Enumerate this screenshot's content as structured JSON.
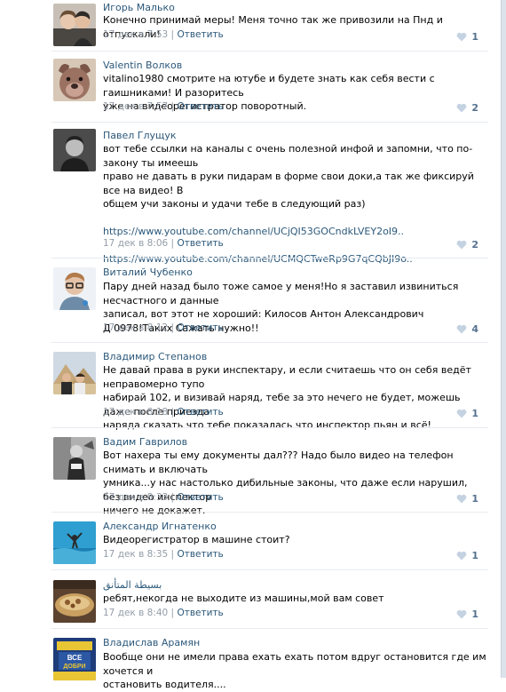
{
  "ui": {
    "reply_label": "Ответить",
    "separator": "|"
  },
  "comments": [
    {
      "author": "Игорь Малько",
      "lines": [
        "Конечно принимай меры! Меня точно так же привозили на Пнд и отпускали!"
      ],
      "time": "17 дек в 7:53",
      "likes": "1"
    },
    {
      "author": "Valentin Волков",
      "lines": [
        "vitalino1980 смотрите на ютубе и будете знать как себя вести с гаишниками! И разоритесь",
        "уже на видеорегистратор поворотный."
      ],
      "time": "17 дек в 7:57",
      "likes": "2"
    },
    {
      "author": "Павел Глущук",
      "lines": [
        "вот тебе ссылки на каналы с очень полезной инфой и запомни, что по-закону ты имеешь",
        "право не давать в руки пидарам в форме свои доки,а так же фиксируй все на видео! В",
        "общем учи законы и удачи тебе в следующий раз)"
      ],
      "links": [
        "https://www.youtube.com/channel/UCjQI53GOCndkLVEY2oI9..",
        "https://www.youtube.com/channel/UCMQCTweRp9G7qCQbJI9o.."
      ],
      "time": "17 дек в 8:06",
      "likes": "2"
    },
    {
      "author": "Виталий Чубенко",
      "lines": [
        "Пару дней назад было тоже самое у меня!Но я заставил извиниться несчастного и данные",
        "записал, вот этот не хороший: Килосов Антон Александрович",
        "Д 0978!Таких Сажать нужно!!"
      ],
      "time": "17 дек в 8:12",
      "likes": "4"
    },
    {
      "author": "Владимир Степанов",
      "lines": [
        "Не давай права в руки инспектару, и если считаешь что он себя ведёт неправомерно тупо",
        "набирай 102, и визивай наряд, тебе за это нечего не будет, можешь даже после приезда",
        "наряда сказать что тебе показалась что инспектор пьян и всё!"
      ],
      "time": "17 дек в 8:18",
      "likes": "1"
    },
    {
      "author": "Вадим Гаврилов",
      "lines": [
        "Вот нахера ты ему документы дал??? Надо было видео на телефон снимать и включать",
        "умника...у нас настолько дибильные законы, что даже если нарушил, без видео инспектор",
        "ничего не докажет."
      ],
      "time": "17 дек в 8:33",
      "likes": "1"
    },
    {
      "author": "Александр Игнатенко",
      "lines": [
        "Видеорегистратор в машине стоит?"
      ],
      "time": "17 дек в 8:35",
      "likes": "1"
    },
    {
      "author": "بسيطة المتأنق",
      "lines": [
        "ребят,некогда не выходите из машины,мой вам совет"
      ],
      "time": "17 дек в 8:40",
      "likes": "1"
    },
    {
      "author": "Владислав Арамян",
      "lines": [
        "Вообще они не имели права ехать ехать потом вдруг остановится где им хочется и",
        "остановить водителя...."
      ],
      "time": "",
      "likes": ""
    }
  ],
  "avatar_texts": {
    "badge_line1": "ВСЕ",
    "badge_line2": "ДОБРИ"
  },
  "icons": {
    "like": "heart-icon"
  },
  "colors": {
    "link": "#2b587a",
    "meta": "#939da8",
    "like": "#5b80a8",
    "like_count": "#54718f",
    "separator": "#e7ebf0"
  }
}
